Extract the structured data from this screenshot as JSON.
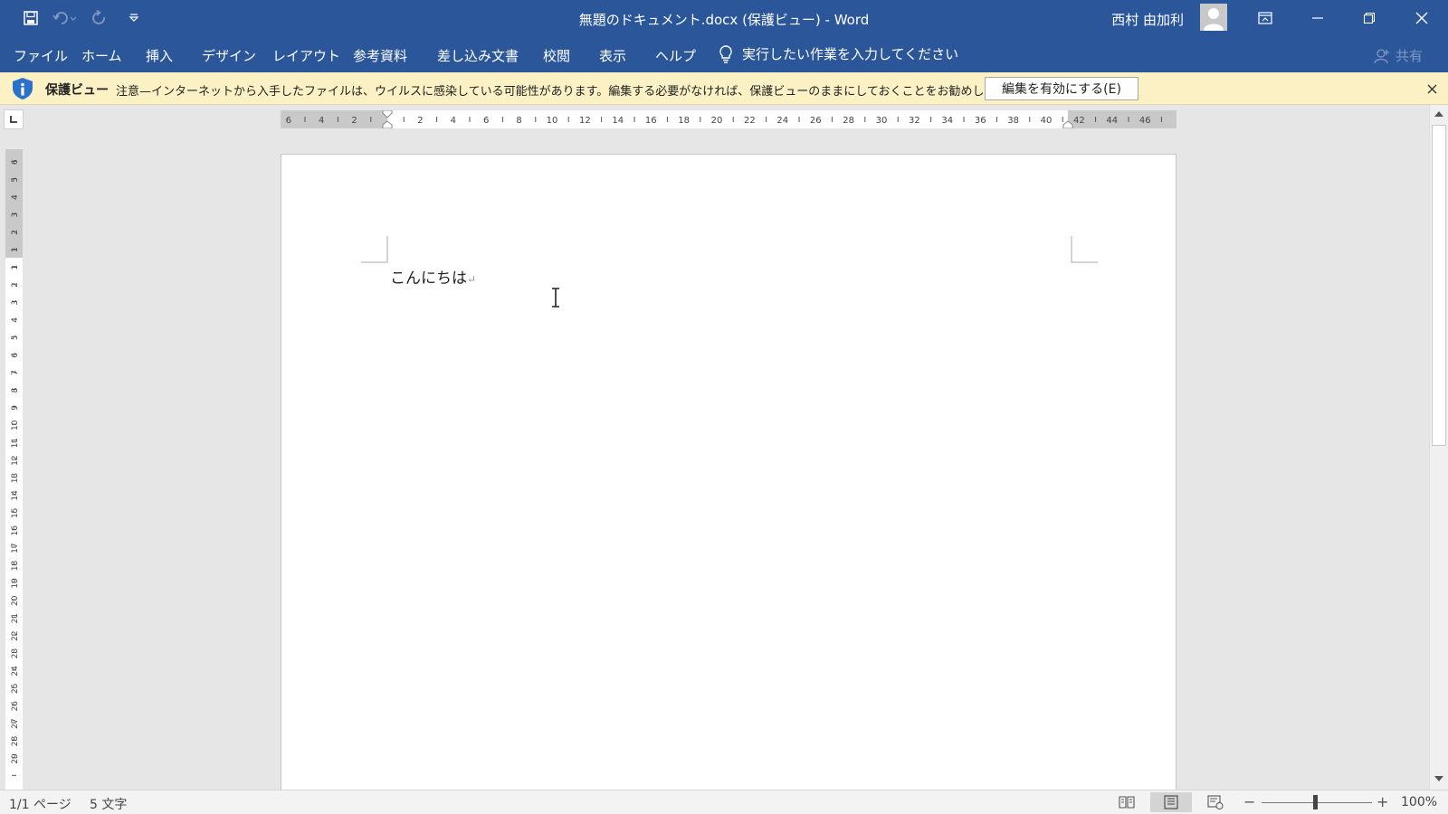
{
  "titlebar": {
    "title": "無題のドキュメント.docx (保護ビュー)  -  Word",
    "user": "西村 由加利",
    "bg_color": "#2b579a"
  },
  "qat": {
    "icons": [
      "save-icon",
      "undo-icon",
      "redo-icon",
      "customize-qat-icon"
    ]
  },
  "ribbon": {
    "tabs": [
      "ファイル",
      "ホーム",
      "挿入",
      "デザイン",
      "レイアウト",
      "参考資料",
      "差し込み文書",
      "校閲",
      "表示",
      "ヘルプ"
    ],
    "tell_me": "実行したい作業を入力してください",
    "share": "共有"
  },
  "protected_view": {
    "title": "保護ビュー",
    "message": "注意—インターネットから入手したファイルは、ウイルスに感染している可能性があります。編集する必要がなければ、保護ビューのままにしておくことをお勧めします。",
    "enable_label": "編集を有効にする(E)",
    "bg_color": "#fbf1c5"
  },
  "rulers": {
    "horizontal_labels": [
      "6",
      "4",
      "2",
      "2",
      "4",
      "6",
      "8",
      "10",
      "12",
      "14",
      "16",
      "18",
      "20",
      "22",
      "24",
      "26",
      "28",
      "30",
      "32",
      "34",
      "36",
      "38",
      "40",
      "42",
      "44",
      "46"
    ],
    "vertical_labels": [
      "6",
      "5",
      "4",
      "3",
      "2",
      "1",
      "1",
      "2",
      "3",
      "4",
      "5",
      "6",
      "7",
      "8",
      "9",
      "10",
      "11",
      "12",
      "13",
      "14",
      "15",
      "16",
      "17",
      "18",
      "19",
      "20",
      "21",
      "22",
      "23",
      "24",
      "25",
      "26",
      "27",
      "28",
      "29"
    ]
  },
  "document": {
    "text": "こんにちは",
    "paragraph_mark": "↵"
  },
  "status": {
    "page": "1/1 ページ",
    "words": "5 文字",
    "zoom": "100%",
    "zoom_minus": "−",
    "zoom_plus": "+"
  }
}
